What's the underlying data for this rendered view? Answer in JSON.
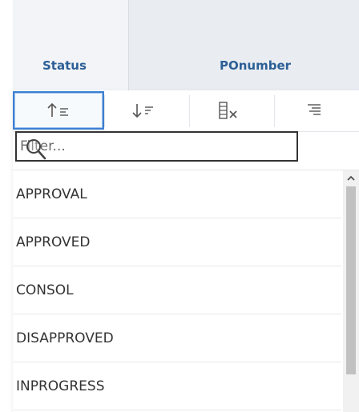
{
  "columns": {
    "status": "Status",
    "ponumber": "POnumber"
  },
  "toolbar": {
    "sort_asc_icon": "sort-ascending-icon",
    "sort_desc_icon": "sort-descending-icon",
    "clear_filter_icon": "clear-filter-icon",
    "menu_icon": "align-right-menu-icon"
  },
  "filter": {
    "placeholder": "Filter...",
    "value": ""
  },
  "list": {
    "items": [
      {
        "label": "APPROVAL"
      },
      {
        "label": "APPROVED"
      },
      {
        "label": "CONSOL"
      },
      {
        "label": "DISAPPROVED"
      },
      {
        "label": "INPROGRESS"
      }
    ]
  },
  "colors": {
    "header_text": "#2c5f96",
    "active_border": "#3d7fd1",
    "icon": "#555555"
  }
}
